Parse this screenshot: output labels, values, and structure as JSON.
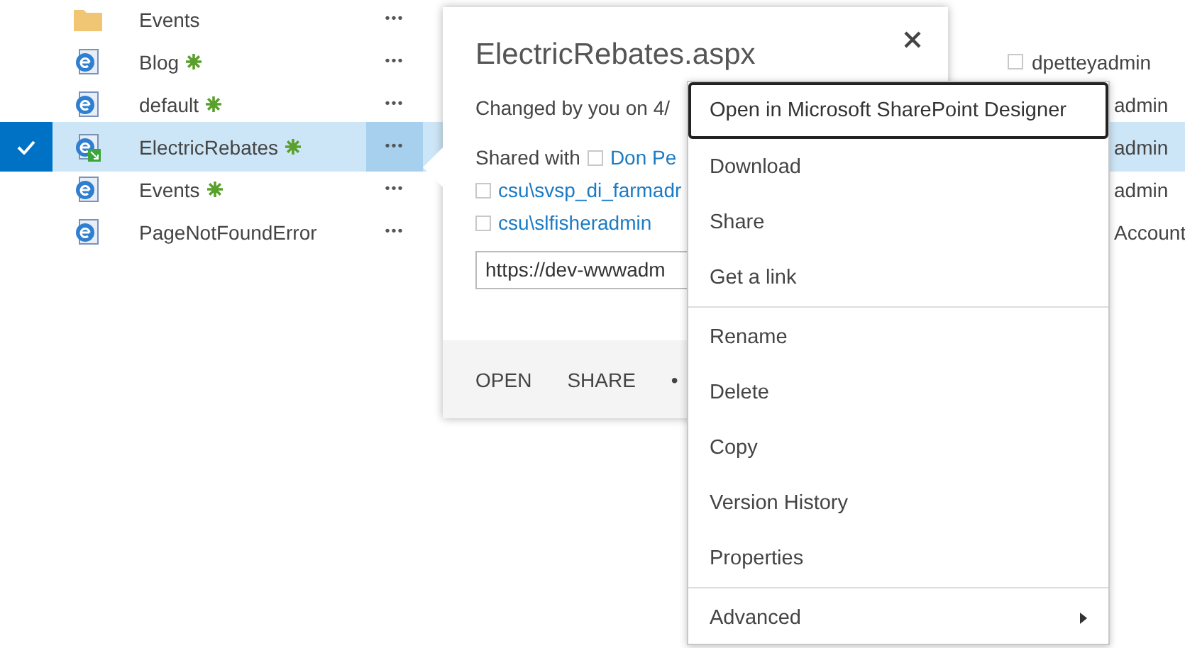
{
  "rows": [
    {
      "kind": "folder",
      "name": "Events",
      "new": false,
      "selected": false,
      "more": "•••"
    },
    {
      "kind": "page",
      "name": "Blog",
      "new": true,
      "selected": false,
      "more": "•••",
      "right": {
        "kind": "checkbox-user",
        "text": "dpetteyadmin",
        "checked": false
      }
    },
    {
      "kind": "page",
      "name": "default",
      "new": true,
      "selected": false,
      "more": "•••",
      "right": {
        "kind": "text",
        "text": "admin"
      }
    },
    {
      "kind": "page-edit",
      "name": "ElectricRebates",
      "new": true,
      "selected": true,
      "more": "•••",
      "right": {
        "kind": "text",
        "text": "admin"
      }
    },
    {
      "kind": "page",
      "name": "Events",
      "new": true,
      "selected": false,
      "more": "•••",
      "right": {
        "kind": "text",
        "text": "admin"
      }
    },
    {
      "kind": "page",
      "name": "PageNotFoundError",
      "new": false,
      "selected": false,
      "more": "•••",
      "right": {
        "kind": "text",
        "text": "Account"
      }
    }
  ],
  "callout": {
    "title": "ElectricRebates.aspx",
    "changed": "Changed by you on 4/",
    "shared_label": "Shared with",
    "shared_with": [
      {
        "name": "Don Pe",
        "checked": false
      },
      {
        "name": "csu\\svsp_di_farmadr",
        "checked": false
      },
      {
        "name": "csu\\slfisheradmin",
        "checked": false
      }
    ],
    "url": "https://dev-wwwadm",
    "actions": [
      "OPEN",
      "SHARE"
    ],
    "more": "•"
  },
  "menu": [
    {
      "kind": "item",
      "label": "Open in Microsoft SharePoint Designer",
      "focused": true
    },
    {
      "kind": "item",
      "label": "Download",
      "focused": false
    },
    {
      "kind": "item",
      "label": "Share",
      "focused": false
    },
    {
      "kind": "item",
      "label": "Get a link",
      "focused": false
    },
    {
      "kind": "separator"
    },
    {
      "kind": "item",
      "label": "Rename",
      "focused": false
    },
    {
      "kind": "item",
      "label": "Delete",
      "focused": false
    },
    {
      "kind": "item",
      "label": "Copy",
      "focused": false
    },
    {
      "kind": "item",
      "label": "Version History",
      "focused": false
    },
    {
      "kind": "item",
      "label": "Properties",
      "focused": false
    },
    {
      "kind": "separator"
    },
    {
      "kind": "submenu",
      "label": "Advanced",
      "focused": false
    }
  ]
}
